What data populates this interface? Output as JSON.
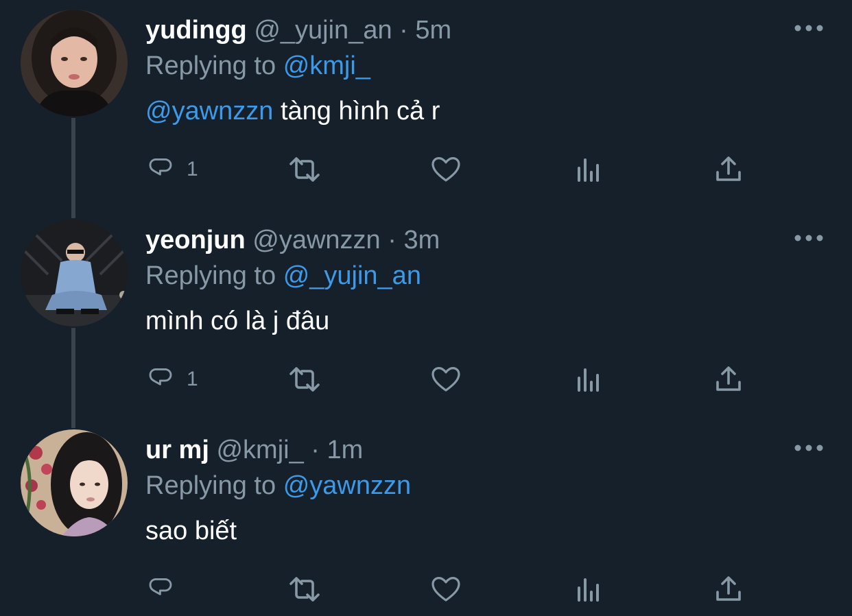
{
  "tweets": [
    {
      "display_name": "yudingg",
      "handle": "@_yujin_an",
      "separator": "·",
      "time": "5m",
      "replying_prefix": "Replying to",
      "replying_to": "@kmji_",
      "text_mention": "@yawnzzn",
      "text": " tàng hình cả r",
      "reply_count": "1",
      "avatar_palette": [
        "#2a2421",
        "#c99c86",
        "#1b1715",
        "#e6bfae"
      ]
    },
    {
      "display_name": "yeonjun",
      "handle": "@yawnzzn",
      "separator": "·",
      "time": "3m",
      "replying_prefix": "Replying to",
      "replying_to": "@_yujin_an",
      "text_mention": "",
      "text": "mình có là j đâu",
      "reply_count": "1",
      "avatar_palette": [
        "#1a1b1f",
        "#7fa0c8",
        "#2b2c31",
        "#d9d9d9"
      ]
    },
    {
      "display_name": "ur mj",
      "handle": "@kmji_",
      "separator": "·",
      "time": "1m",
      "replying_prefix": "Replying to",
      "replying_to": "@yawnzzn",
      "text_mention": "",
      "text": "sao biết",
      "reply_count": "",
      "avatar_palette": [
        "#c9b49a",
        "#1d1a1c",
        "#efd6c8",
        "#b33a4a"
      ]
    }
  ],
  "icons": {
    "reply": "speech-bubble-icon",
    "retweet": "retweet-icon",
    "like": "heart-icon",
    "analytics": "bar-chart-icon",
    "share": "share-icon",
    "more": "ellipsis-icon"
  },
  "colors": {
    "background": "#15202b",
    "text": "#ffffff",
    "muted": "#8899a6",
    "link": "#3d9ae8",
    "thread_line": "#38444d"
  }
}
